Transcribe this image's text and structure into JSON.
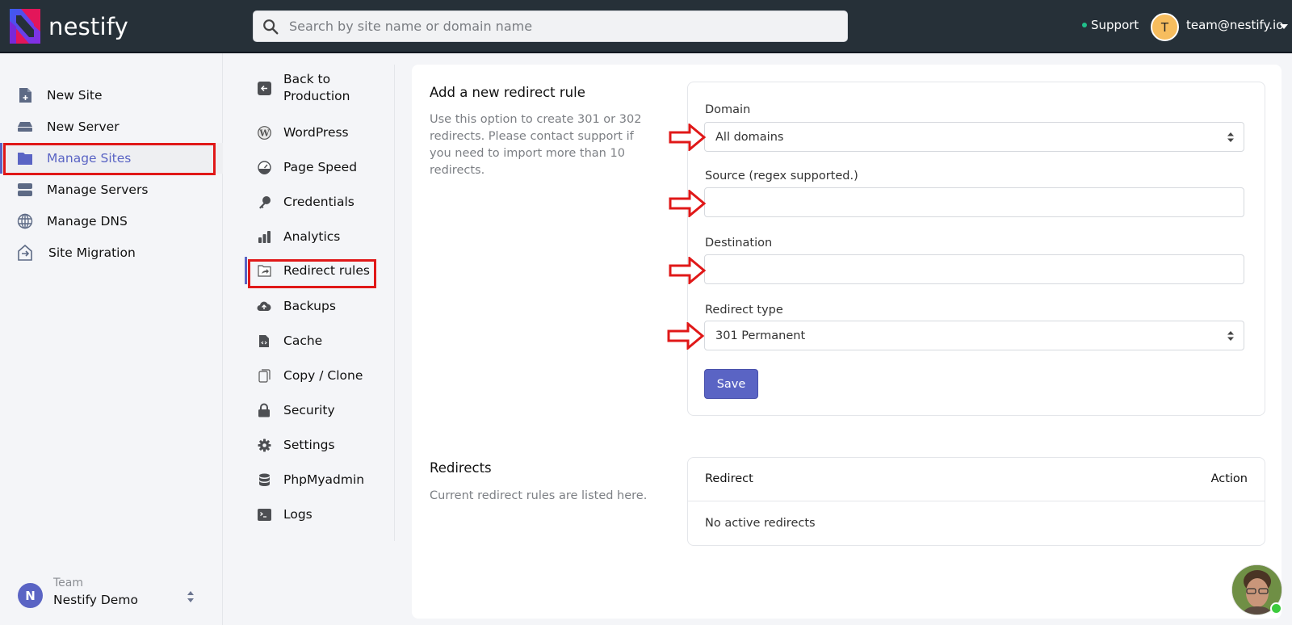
{
  "app": {
    "brand": "nestify"
  },
  "colors": {
    "accent": "#5a64c4",
    "topbar": "#263038",
    "highlight": "#e01818",
    "support_dot": "#20c08a",
    "user_avatar": "#f7bd5e"
  },
  "header": {
    "search_placeholder": "Search by site name or domain name",
    "support_label": "Support",
    "user_initial": "T",
    "user_email": "team@nestify.io"
  },
  "sidebar": {
    "items": [
      {
        "label": "New Site",
        "icon": "file-plus-icon"
      },
      {
        "label": "New Server",
        "icon": "server-icon"
      },
      {
        "label": "Manage Sites",
        "icon": "folder-icon",
        "active": true
      },
      {
        "label": "Manage Servers",
        "icon": "servers-icon"
      },
      {
        "label": "Manage DNS",
        "icon": "globe-icon"
      },
      {
        "label": "Site Migration",
        "icon": "migration-icon"
      }
    ],
    "team": {
      "initial": "N",
      "label": "Team",
      "name": "Nestify Demo"
    }
  },
  "subnav": {
    "items": [
      {
        "label": "Back to Production",
        "icon": "arrow-left-icon"
      },
      {
        "label": "WordPress",
        "icon": "wordpress-icon"
      },
      {
        "label": "Page Speed",
        "icon": "speedometer-icon"
      },
      {
        "label": "Credentials",
        "icon": "key-icon"
      },
      {
        "label": "Analytics",
        "icon": "bar-chart-icon"
      },
      {
        "label": "Redirect rules",
        "icon": "folder-share-icon",
        "active": true
      },
      {
        "label": "Backups",
        "icon": "cloud-upload-icon"
      },
      {
        "label": "Cache",
        "icon": "file-code-icon"
      },
      {
        "label": "Copy / Clone",
        "icon": "copy-icon"
      },
      {
        "label": "Security",
        "icon": "lock-icon"
      },
      {
        "label": "Settings",
        "icon": "gear-icon"
      },
      {
        "label": "PhpMyadmin",
        "icon": "database-icon"
      },
      {
        "label": "Logs",
        "icon": "terminal-icon"
      }
    ]
  },
  "add_rule": {
    "title": "Add a new redirect rule",
    "description": "Use this option to create 301 or 302 redirects. Please contact support if you need to import more than 10 redirects.",
    "domain": {
      "label": "Domain",
      "value": "All domains"
    },
    "source": {
      "label": "Source (regex supported.)",
      "value": ""
    },
    "destination": {
      "label": "Destination",
      "value": ""
    },
    "redirect_type": {
      "label": "Redirect type",
      "value": "301 Permanent"
    },
    "save_label": "Save"
  },
  "redirects": {
    "title": "Redirects",
    "description": "Current redirect rules are listed here.",
    "columns": [
      "Redirect",
      "Action"
    ],
    "rows": [],
    "empty_text": "No active redirects"
  }
}
